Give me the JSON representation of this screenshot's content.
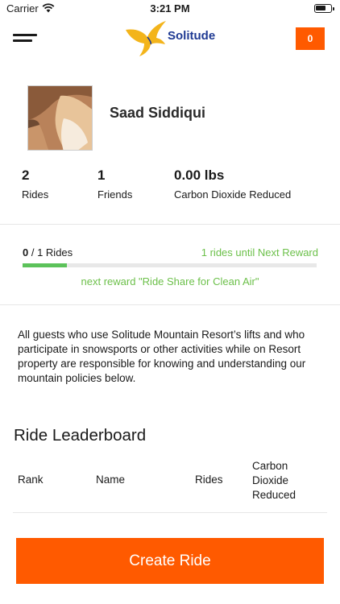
{
  "status_bar": {
    "carrier": "Carrier",
    "time": "3:21 PM"
  },
  "header": {
    "logo_text": "Solitude",
    "cart_count": "0",
    "accent_color": "#ff5a00"
  },
  "profile": {
    "name": "Saad Siddiqui"
  },
  "stats": [
    {
      "value": "2",
      "label": "Rides"
    },
    {
      "value": "1",
      "label": "Friends"
    },
    {
      "value": "0.00 lbs",
      "label": "Carbon Dioxide Reduced"
    }
  ],
  "progress": {
    "current": "0",
    "total_text": " / 1 Rides",
    "until_next": "1 rides until Next Reward",
    "next_reward": "next reward \"Ride Share for Clean Air\"",
    "fill_fraction": 0.15,
    "bar_color": "#5cc25a"
  },
  "policy_text": "All guests who use Solitude Mountain Resort’s lifts and who participate in snowsports or other activities while on Resort property are responsible for knowing and understanding our mountain policies below.",
  "leaderboard": {
    "title": "Ride Leaderboard",
    "columns": {
      "rank": "Rank",
      "name": "Name",
      "rides": "Rides",
      "carbon": "Carbon Dioxide Reduced"
    }
  },
  "cta": {
    "label": "Create Ride"
  }
}
